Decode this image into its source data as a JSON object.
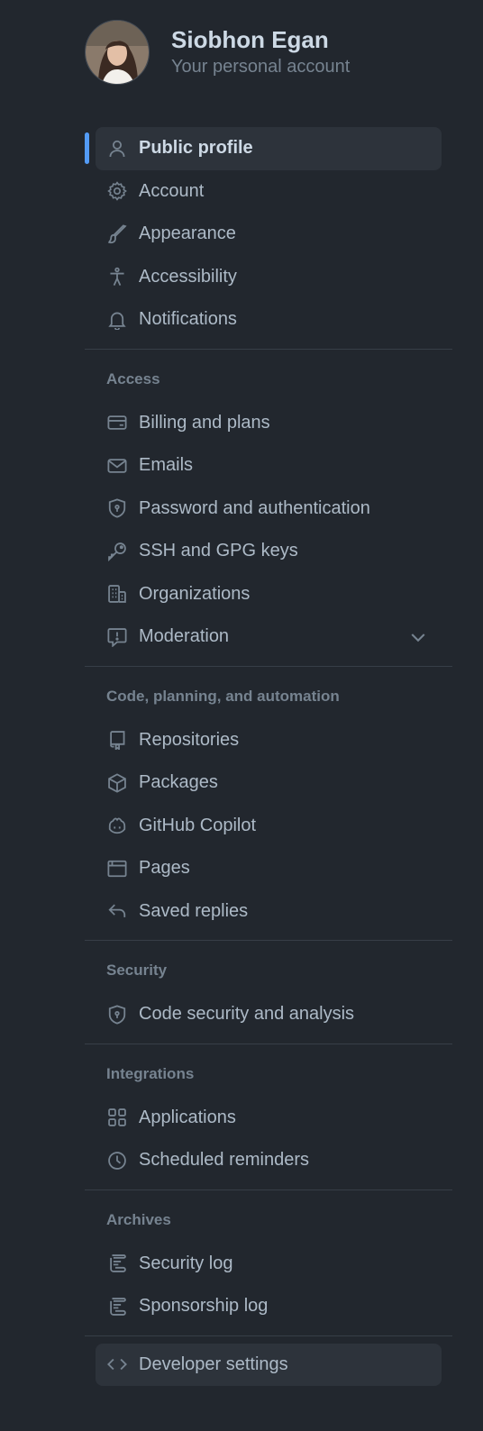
{
  "profile": {
    "name": "Siobhon Egan",
    "subtitle": "Your personal account"
  },
  "colors": {
    "background": "#22272e",
    "active_bg": "#2d333b",
    "accent": "#539bf5",
    "text": "#adbac7",
    "muted": "#768390",
    "divider": "#373e47"
  },
  "nav": {
    "general": [
      {
        "label": "Public profile",
        "icon": "person-icon",
        "active": true
      },
      {
        "label": "Account",
        "icon": "gear-icon"
      },
      {
        "label": "Appearance",
        "icon": "paintbrush-icon"
      },
      {
        "label": "Accessibility",
        "icon": "accessibility-icon"
      },
      {
        "label": "Notifications",
        "icon": "bell-icon"
      }
    ],
    "access": {
      "heading": "Access",
      "items": [
        {
          "label": "Billing and plans",
          "icon": "credit-card-icon"
        },
        {
          "label": "Emails",
          "icon": "mail-icon"
        },
        {
          "label": "Password and authentication",
          "icon": "shield-lock-icon"
        },
        {
          "label": "SSH and GPG keys",
          "icon": "key-icon"
        },
        {
          "label": "Organizations",
          "icon": "organization-icon"
        },
        {
          "label": "Moderation",
          "icon": "report-icon",
          "expandable": true
        }
      ]
    },
    "code": {
      "heading": "Code, planning, and automation",
      "items": [
        {
          "label": "Repositories",
          "icon": "repo-icon"
        },
        {
          "label": "Packages",
          "icon": "package-icon"
        },
        {
          "label": "GitHub Copilot",
          "icon": "copilot-icon"
        },
        {
          "label": "Pages",
          "icon": "browser-icon"
        },
        {
          "label": "Saved replies",
          "icon": "reply-icon"
        }
      ]
    },
    "security": {
      "heading": "Security",
      "items": [
        {
          "label": "Code security and analysis",
          "icon": "shield-lock-icon"
        }
      ]
    },
    "integrations": {
      "heading": "Integrations",
      "items": [
        {
          "label": "Applications",
          "icon": "apps-icon"
        },
        {
          "label": "Scheduled reminders",
          "icon": "clock-icon"
        }
      ]
    },
    "archives": {
      "heading": "Archives",
      "items": [
        {
          "label": "Security log",
          "icon": "log-icon"
        },
        {
          "label": "Sponsorship log",
          "icon": "log-icon"
        }
      ]
    },
    "developer": {
      "label": "Developer settings",
      "icon": "code-icon"
    }
  }
}
